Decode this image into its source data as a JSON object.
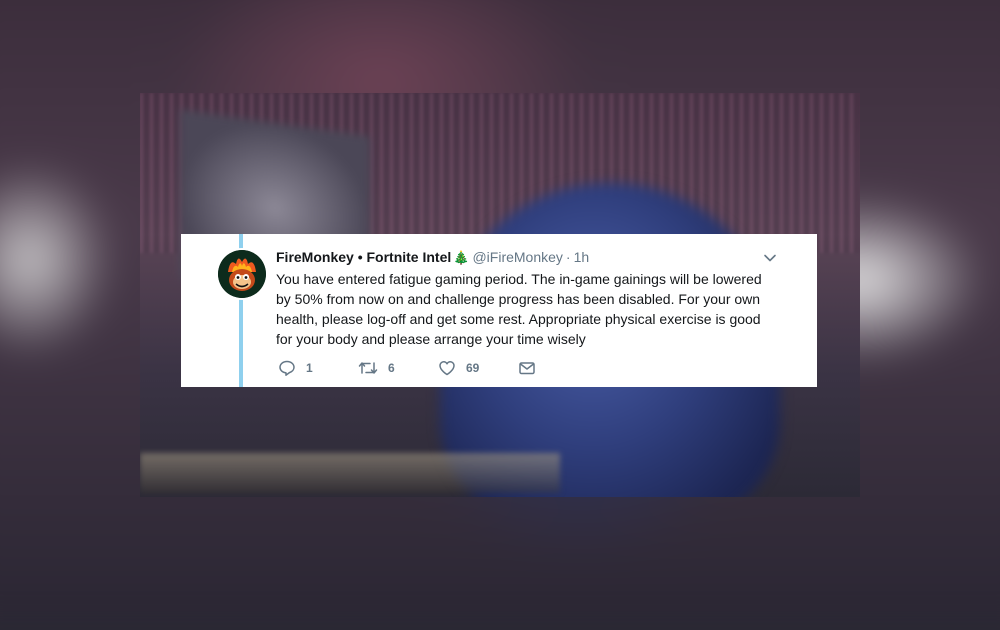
{
  "tweet": {
    "display_name": "FireMonkey • Fortnite Intel",
    "name_emoji": "🎄",
    "handle": "@iFireMonkey",
    "separator": "·",
    "timestamp": "1h",
    "text": "You have entered fatigue gaming period. The in-game gainings will be lowered by 50% from now on and challenge progress has been disabled. For your own health, please log-off and get some rest. Appropriate physical exercise is good for your body and please arrange your time wisely",
    "replies": "1",
    "retweets": "6",
    "likes": "69"
  },
  "icons": {
    "reply": "reply-bubble-icon",
    "retweet": "retweet-icon",
    "like": "heart-icon",
    "dm": "envelope-icon",
    "menu": "chevron-down-icon",
    "avatar": "flaming-monkey-avatar"
  },
  "colors": {
    "thread_line": "#8fd0ee",
    "muted_text": "#657786",
    "main_text": "#14171a",
    "card_bg": "#ffffff"
  }
}
